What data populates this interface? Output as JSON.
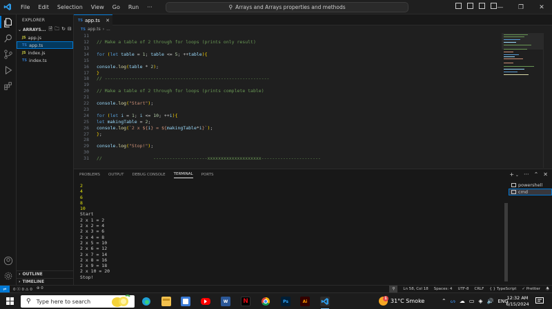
{
  "titlebar": {
    "menu": [
      "File",
      "Edit",
      "Selection",
      "View",
      "Go",
      "Run",
      "···"
    ],
    "command_center": "Arrays and Arrays properties and methods",
    "accent": "#0078d4"
  },
  "sidebar": {
    "header": "EXPLORER",
    "folder": "ARRAYS...",
    "files": [
      {
        "badge": "JS",
        "name": "app.js",
        "active": false
      },
      {
        "badge": "TS",
        "name": "app.ts",
        "active": true
      },
      {
        "badge": "JS",
        "name": "index.js",
        "active": false
      },
      {
        "badge": "TS",
        "name": "index.ts",
        "active": false
      }
    ],
    "outline": "OUTLINE",
    "timeline": "TIMELINE"
  },
  "editor": {
    "tab": {
      "badge": "TS",
      "label": "app.ts"
    },
    "breadcrumb": {
      "badge": "TS",
      "file": "app.ts",
      "rest": "..."
    },
    "lines": [
      {
        "n": "11",
        "tokens": []
      },
      {
        "n": "12",
        "tokens": [
          {
            "t": "// Make a table of 2 through for loops (prints only result)",
            "c": "c-com"
          }
        ]
      },
      {
        "n": "13",
        "tokens": []
      },
      {
        "n": "14",
        "tokens": [
          {
            "t": "for",
            "c": "c-kw"
          },
          {
            "t": " ",
            "c": ""
          },
          {
            "t": "(",
            "c": "c-brk"
          },
          {
            "t": "let",
            "c": "c-kw"
          },
          {
            "t": " ",
            "c": ""
          },
          {
            "t": "table",
            "c": "c-var"
          },
          {
            "t": " = ",
            "c": ""
          },
          {
            "t": "1",
            "c": "c-num"
          },
          {
            "t": "; ",
            "c": ""
          },
          {
            "t": "table",
            "c": "c-var"
          },
          {
            "t": " <= ",
            "c": ""
          },
          {
            "t": "5",
            "c": "c-num"
          },
          {
            "t": "; ++",
            "c": ""
          },
          {
            "t": "table",
            "c": "c-var"
          },
          {
            "t": ")",
            "c": "c-brk"
          },
          {
            "t": "{",
            "c": "c-brk"
          }
        ]
      },
      {
        "n": "15",
        "tokens": []
      },
      {
        "n": "16",
        "tokens": [
          {
            "t": "console",
            "c": "c-var"
          },
          {
            "t": ".",
            "c": ""
          },
          {
            "t": "log",
            "c": "c-fn"
          },
          {
            "t": "(",
            "c": "c-brk"
          },
          {
            "t": "table",
            "c": "c-var"
          },
          {
            "t": " * ",
            "c": ""
          },
          {
            "t": "2",
            "c": "c-num"
          },
          {
            "t": ")",
            "c": "c-brk"
          },
          {
            "t": ";",
            "c": ""
          }
        ]
      },
      {
        "n": "17",
        "tokens": [
          {
            "t": "}",
            "c": "c-brk"
          }
        ]
      },
      {
        "n": "18",
        "tokens": [
          {
            "t": "// -------------------------------------------------------------",
            "c": "c-com"
          }
        ]
      },
      {
        "n": "19",
        "tokens": []
      },
      {
        "n": "20",
        "tokens": [
          {
            "t": "// Make a table of 2 through for loops (prints complete table)",
            "c": "c-com"
          }
        ]
      },
      {
        "n": "21",
        "tokens": []
      },
      {
        "n": "22",
        "tokens": [
          {
            "t": "console",
            "c": "c-var"
          },
          {
            "t": ".",
            "c": ""
          },
          {
            "t": "log",
            "c": "c-fn"
          },
          {
            "t": "(",
            "c": "c-brk"
          },
          {
            "t": "\"Start\"",
            "c": "c-str"
          },
          {
            "t": ")",
            "c": "c-brk"
          },
          {
            "t": ";",
            "c": ""
          }
        ]
      },
      {
        "n": "23",
        "tokens": []
      },
      {
        "n": "24",
        "tokens": [
          {
            "t": "for",
            "c": "c-kw"
          },
          {
            "t": " ",
            "c": ""
          },
          {
            "t": "(",
            "c": "c-brk"
          },
          {
            "t": "let",
            "c": "c-kw"
          },
          {
            "t": " ",
            "c": ""
          },
          {
            "t": "i",
            "c": "c-var"
          },
          {
            "t": " = ",
            "c": ""
          },
          {
            "t": "1",
            "c": "c-num"
          },
          {
            "t": "; ",
            "c": ""
          },
          {
            "t": "i",
            "c": "c-var"
          },
          {
            "t": " <= ",
            "c": ""
          },
          {
            "t": "10",
            "c": "c-num"
          },
          {
            "t": "; ++",
            "c": ""
          },
          {
            "t": "i",
            "c": "c-var"
          },
          {
            "t": ")",
            "c": "c-brk"
          },
          {
            "t": "{",
            "c": "c-brk"
          }
        ]
      },
      {
        "n": "25",
        "tokens": [
          {
            "t": "let",
            "c": "c-kw"
          },
          {
            "t": " ",
            "c": ""
          },
          {
            "t": "makingTable",
            "c": "c-var"
          },
          {
            "t": " = ",
            "c": ""
          },
          {
            "t": "2",
            "c": "c-num"
          },
          {
            "t": ";",
            "c": ""
          }
        ]
      },
      {
        "n": "26",
        "tokens": [
          {
            "t": "console",
            "c": "c-var"
          },
          {
            "t": ".",
            "c": ""
          },
          {
            "t": "log",
            "c": "c-fn"
          },
          {
            "t": "(",
            "c": "c-brk"
          },
          {
            "t": "`2 x ${",
            "c": "c-str"
          },
          {
            "t": "i",
            "c": "c-var"
          },
          {
            "t": "} = ${",
            "c": "c-str"
          },
          {
            "t": "makingTable",
            "c": "c-var"
          },
          {
            "t": "*",
            "c": ""
          },
          {
            "t": "i",
            "c": "c-var"
          },
          {
            "t": "}`",
            "c": "c-str"
          },
          {
            "t": ")",
            "c": "c-brk"
          },
          {
            "t": ";",
            "c": ""
          }
        ]
      },
      {
        "n": "27",
        "tokens": [
          {
            "t": "}",
            "c": "c-brk"
          },
          {
            "t": ";",
            "c": ""
          }
        ]
      },
      {
        "n": "28",
        "tokens": []
      },
      {
        "n": "29",
        "tokens": [
          {
            "t": "console",
            "c": "c-var"
          },
          {
            "t": ".",
            "c": ""
          },
          {
            "t": "log",
            "c": "c-fn"
          },
          {
            "t": "(",
            "c": "c-brk"
          },
          {
            "t": "\"Stop!\"",
            "c": "c-str"
          },
          {
            "t": ")",
            "c": "c-brk"
          },
          {
            "t": ";",
            "c": ""
          }
        ]
      },
      {
        "n": "30",
        "tokens": []
      },
      {
        "n": "31",
        "tokens": [
          {
            "t": "//                   --------------------xxxxxxxxxxxxxxxxxxxx----------------------",
            "c": "c-com"
          }
        ]
      }
    ]
  },
  "panel": {
    "tabs": [
      "PROBLEMS",
      "OUTPUT",
      "DEBUG CONSOLE",
      "TERMINAL",
      "PORTS"
    ],
    "active_tab": "TERMINAL",
    "terminals": [
      "powershell",
      "cmd"
    ],
    "active_terminal": "cmd",
    "output_yellow": [
      "2",
      "4",
      "6",
      "8",
      "10"
    ],
    "output": [
      "Start",
      "2 x 1 = 2",
      "2 x 2 = 4",
      "2 x 3 = 6",
      "2 x 4 = 8",
      "2 x 5 = 10",
      "2 x 6 = 12",
      "2 x 7 = 14",
      "2 x 8 = 16",
      "2 x 9 = 18",
      "2 x 10 = 20",
      "Stop!"
    ]
  },
  "statusbar": {
    "problems": "0 ⓧ 0 ⚠ 0",
    "ports": "0",
    "position": "Ln 58, Col 18",
    "spaces": "Spaces: 4",
    "encoding": "UTF-8",
    "eol": "CRLF",
    "language": "TypeScript",
    "prettier": "Prettier"
  },
  "taskbar": {
    "search_placeholder": "Type here to search",
    "weather": "31°C  Smoke",
    "weather_badge": "1",
    "language": "ENG",
    "time": "12:32 AM",
    "date": "6/15/2024"
  }
}
